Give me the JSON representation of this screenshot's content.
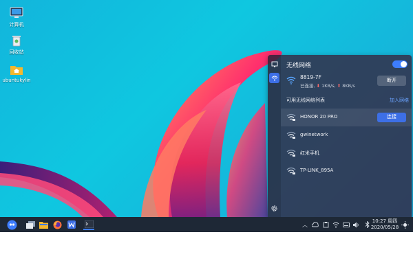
{
  "desktop": {
    "icons": [
      {
        "label": "计算机",
        "icon": "computer-icon"
      },
      {
        "label": "回收站",
        "icon": "trash-icon"
      },
      {
        "label": "ubuntukylin",
        "icon": "home-folder-icon"
      }
    ]
  },
  "network_panel": {
    "title": "无线网络",
    "wifi_enabled": true,
    "current": {
      "name": "8819-7F",
      "status": "已连接",
      "down_rate": "1KB/s",
      "up_rate": "8KB/s",
      "disconnect_label": "断开"
    },
    "available_label": "可用无线网络列表",
    "add_network_label": "加入网络",
    "networks": [
      {
        "name": "HONOR 20 PRO",
        "selected": true,
        "connect_label": "连接"
      },
      {
        "name": "gwinetwork",
        "selected": false
      },
      {
        "name": "红米手机",
        "selected": false
      },
      {
        "name": "TP-LINK_895A",
        "selected": false
      }
    ]
  },
  "taskbar": {
    "clock": {
      "time": "10:27 周四",
      "date": "2020/05/28"
    }
  },
  "colors": {
    "accent": "#3d7dff",
    "panel_bg": "#342842",
    "taskbar_bg": "#1e2836"
  }
}
